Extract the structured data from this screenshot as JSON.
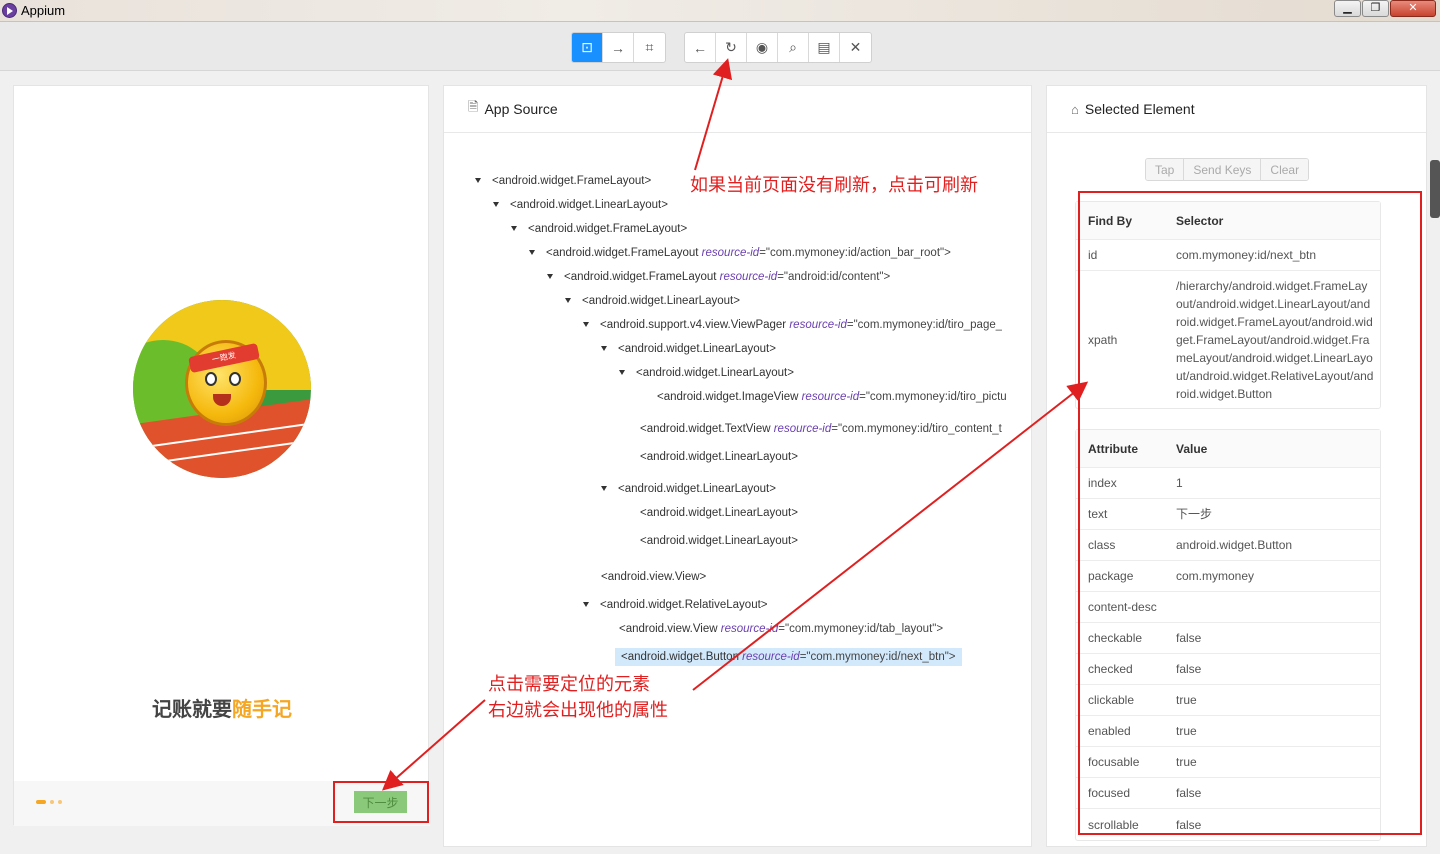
{
  "window": {
    "title": "Appium"
  },
  "toolbar": {
    "group1": [
      {
        "name": "select-element-icon",
        "glyph": "⊡",
        "active": true
      },
      {
        "name": "swipe-icon",
        "glyph": "→",
        "active": false
      },
      {
        "name": "tap-coordinates-icon",
        "glyph": "⌗",
        "active": false
      }
    ],
    "group2": [
      {
        "name": "back-icon",
        "glyph": "←"
      },
      {
        "name": "refresh-icon",
        "glyph": "↻"
      },
      {
        "name": "eye-icon",
        "glyph": "◉"
      },
      {
        "name": "search-icon",
        "glyph": "⌕"
      },
      {
        "name": "copy-xml-icon",
        "glyph": "▤"
      },
      {
        "name": "close-icon",
        "glyph": "✕"
      }
    ]
  },
  "device": {
    "slogan_part1": "记账就要",
    "slogan_part2": "随手记",
    "headband_text": "一跑发",
    "next_button": "下一步"
  },
  "source": {
    "title": "App Source",
    "nodes": [
      {
        "depth": 0,
        "caret": true,
        "tag": "<android.widget.FrameLayout>"
      },
      {
        "depth": 1,
        "caret": true,
        "tag": "<android.widget.LinearLayout>"
      },
      {
        "depth": 2,
        "caret": true,
        "tag": "<android.widget.FrameLayout>"
      },
      {
        "depth": 3,
        "caret": true,
        "tag": "<android.widget.FrameLayout ",
        "attr": "resource-id",
        "val": "=\"com.mymoney:id/action_bar_root\">"
      },
      {
        "depth": 4,
        "caret": true,
        "tag": "<android.widget.FrameLayout ",
        "attr": "resource-id",
        "val": "=\"android:id/content\">"
      },
      {
        "depth": 5,
        "caret": true,
        "tag": "<android.widget.LinearLayout>"
      },
      {
        "depth": 6,
        "caret": true,
        "tag": "<android.support.v4.view.ViewPager ",
        "attr": "resource-id",
        "val": "=\"com.mymoney:id/tiro_page_"
      },
      {
        "depth": 7,
        "caret": true,
        "tag": "<android.widget.LinearLayout>"
      },
      {
        "depth": 8,
        "caret": true,
        "tag": "<android.widget.LinearLayout>"
      },
      {
        "depth": 9,
        "caret": false,
        "tag": "<android.widget.ImageView ",
        "attr": "resource-id",
        "val": "=\"com.mymoney:id/tiro_pictu"
      },
      {
        "depth": 8,
        "caret": false,
        "tag": "<android.widget.TextView ",
        "attr": "resource-id",
        "val": "=\"com.mymoney:id/tiro_content_t"
      },
      {
        "depth": 8,
        "caret": false,
        "tag": "<android.widget.LinearLayout>"
      },
      {
        "depth": 7,
        "caret": true,
        "tag": "<android.widget.LinearLayout>"
      },
      {
        "depth": 8,
        "caret": false,
        "tag": "<android.widget.LinearLayout>"
      },
      {
        "depth": 8,
        "caret": false,
        "tag": "<android.widget.LinearLayout>"
      },
      {
        "depth": 6,
        "caret": false,
        "tag": "<android.view.View>"
      },
      {
        "depth": 6,
        "caret": true,
        "tag": "<android.widget.RelativeLayout>"
      },
      {
        "depth": 7,
        "caret": false,
        "tag": "<android.view.View ",
        "attr": "resource-id",
        "val": "=\"com.mymoney:id/tab_layout\">"
      },
      {
        "depth": 7,
        "caret": false,
        "tag": "<android.widget.Button ",
        "attr": "resource-id",
        "val": "=\"com.mymoney:id/next_btn\">",
        "selected": true
      }
    ]
  },
  "annotations": {
    "refresh_note": "如果当前页面没有刷新，点击可刷新",
    "click_note_line1": "点击需要定位的元素",
    "click_note_line2": "右边就会出现他的属性"
  },
  "selected": {
    "title": "Selected Element",
    "actions": [
      "Tap",
      "Send Keys",
      "Clear"
    ],
    "findby_header": {
      "k": "Find By",
      "v": "Selector"
    },
    "findby": [
      {
        "k": "id",
        "v": "com.mymoney:id/next_btn"
      },
      {
        "k": "xpath",
        "v": "/hierarchy/android.widget.FrameLayout/android.widget.LinearLayout/android.widget.FrameLayout/android.widget.FrameLayout/android.widget.FrameLayout/android.widget.LinearLayout/android.widget.RelativeLayout/android.widget.Button"
      }
    ],
    "attr_header": {
      "k": "Attribute",
      "v": "Value"
    },
    "attributes": [
      {
        "k": "index",
        "v": "1"
      },
      {
        "k": "text",
        "v": "下一步"
      },
      {
        "k": "class",
        "v": "android.widget.Button"
      },
      {
        "k": "package",
        "v": "com.mymoney"
      },
      {
        "k": "content-desc",
        "v": ""
      },
      {
        "k": "checkable",
        "v": "false"
      },
      {
        "k": "checked",
        "v": "false"
      },
      {
        "k": "clickable",
        "v": "true"
      },
      {
        "k": "enabled",
        "v": "true"
      },
      {
        "k": "focusable",
        "v": "true"
      },
      {
        "k": "focused",
        "v": "false"
      },
      {
        "k": "scrollable",
        "v": "false"
      }
    ]
  },
  "colors": {
    "accent": "#1890ff",
    "annotation": "#e02020",
    "highlight": "#d2e8fb"
  }
}
